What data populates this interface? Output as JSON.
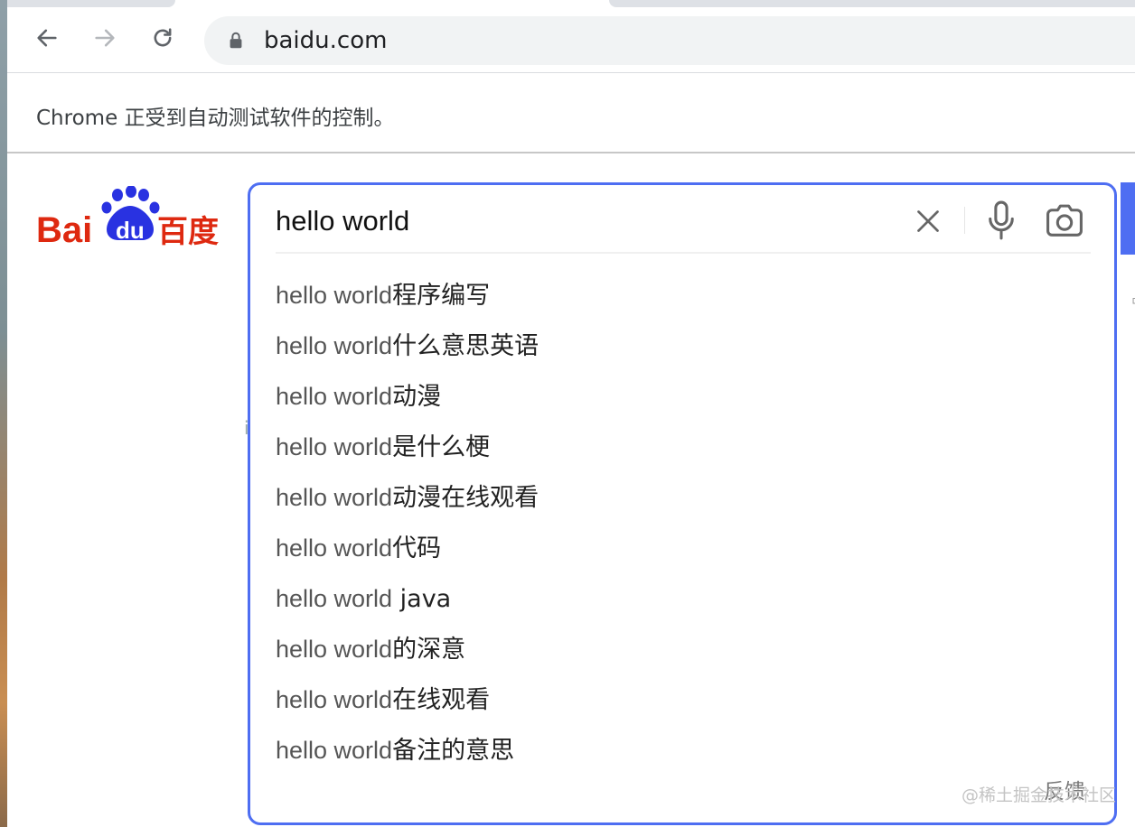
{
  "browser": {
    "url": "baidu.com",
    "infobar_text": "Chrome 正受到自动测试软件的控制。",
    "icons": [
      "back-arrow-icon",
      "forward-arrow-icon",
      "reload-icon",
      "lock-icon"
    ]
  },
  "logo": {
    "text": "Bai du 百度",
    "colors": {
      "red": "#de2910",
      "blue": "#2932e1"
    }
  },
  "search": {
    "query": "hello world",
    "accent_color": "#4e6ef2",
    "icons": [
      "clear-icon",
      "microphone-icon",
      "camera-icon"
    ]
  },
  "suggestions": [
    {
      "query_part": "hello world",
      "rest": "程序编写"
    },
    {
      "query_part": "hello world",
      "rest": "什么意思英语"
    },
    {
      "query_part": "hello world",
      "rest": "动漫"
    },
    {
      "query_part": "hello world",
      "rest": "是什么梗"
    },
    {
      "query_part": "hello world",
      "rest": "动漫在线观看"
    },
    {
      "query_part": "hello world",
      "rest": "代码"
    },
    {
      "query_part": "hello world",
      "rest": " java"
    },
    {
      "query_part": "hello world",
      "rest": "的深意"
    },
    {
      "query_part": "hello world",
      "rest": "在线观看"
    },
    {
      "query_part": "hello world",
      "rest": "备注的意思"
    }
  ],
  "feedback_label": "反馈",
  "watermark": "@稀土掘金技术社区"
}
